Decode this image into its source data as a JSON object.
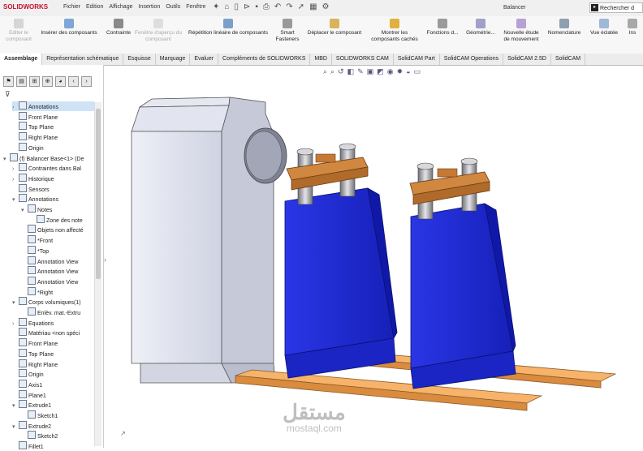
{
  "app": {
    "brand": "SOLIDWORKS",
    "document_title": "Balancer",
    "search_placeholder": "Rechercher d"
  },
  "menu": [
    "Fichier",
    "Edition",
    "Affichage",
    "Insertion",
    "Outils",
    "Fenêtre"
  ],
  "ribbon": {
    "commands": [
      {
        "label": "Editer le composant",
        "enabled": false
      },
      {
        "label": "Insérer des composants",
        "enabled": true
      },
      {
        "label": "Contrainte",
        "enabled": true
      },
      {
        "label": "Fenêtre d'aperçu du composant",
        "enabled": false
      },
      {
        "label": "Répétition linéaire de composants",
        "enabled": true
      },
      {
        "label": "Smart Fasteners",
        "enabled": true
      },
      {
        "label": "Déplacer le composant",
        "enabled": true
      },
      {
        "label": "Montrer les composants cachés",
        "enabled": true
      },
      {
        "label": "Fonctions d...",
        "enabled": true
      },
      {
        "label": "Géométrie...",
        "enabled": true
      },
      {
        "label": "Nouvelle étude de mouvement",
        "enabled": true
      },
      {
        "label": "Nomenclature",
        "enabled": true
      },
      {
        "label": "Vue éclatée",
        "enabled": true
      },
      {
        "label": "Ins",
        "enabled": true
      }
    ]
  },
  "command_tabs": [
    "Assemblage",
    "Représentation schématique",
    "Esquisse",
    "Marquage",
    "Evaluer",
    "Compléments de SOLIDWORKS",
    "MBD",
    "SOLIDWORKS CAM",
    "SolidCAM Part",
    "SolidCAM Operations",
    "SolidCAM 2.5D",
    "SolidCAM"
  ],
  "feature_tree": [
    {
      "label": "Annotations",
      "indent": 1,
      "exp": "›",
      "selected": true
    },
    {
      "label": "Front Plane",
      "indent": 1,
      "exp": ""
    },
    {
      "label": "Top Plane",
      "indent": 1,
      "exp": ""
    },
    {
      "label": "Right Plane",
      "indent": 1,
      "exp": ""
    },
    {
      "label": "Origin",
      "indent": 1,
      "exp": ""
    },
    {
      "label": "(f) Balancer Base<1> (De",
      "indent": 0,
      "exp": "▾"
    },
    {
      "label": "Contraintes dans Bal",
      "indent": 1,
      "exp": "›"
    },
    {
      "label": "Historique",
      "indent": 1,
      "exp": "›"
    },
    {
      "label": "Sensors",
      "indent": 1,
      "exp": ""
    },
    {
      "label": "Annotations",
      "indent": 1,
      "exp": "▾"
    },
    {
      "label": "Notes",
      "indent": 2,
      "exp": "▾"
    },
    {
      "label": "Zone des note",
      "indent": 3,
      "exp": ""
    },
    {
      "label": "Objets non affecté",
      "indent": 2,
      "exp": ""
    },
    {
      "label": "*Front",
      "indent": 2,
      "exp": ""
    },
    {
      "label": "*Top",
      "indent": 2,
      "exp": ""
    },
    {
      "label": "Annotation View",
      "indent": 2,
      "exp": ""
    },
    {
      "label": "Annotation View",
      "indent": 2,
      "exp": ""
    },
    {
      "label": "Annotation View",
      "indent": 2,
      "exp": ""
    },
    {
      "label": "*Right",
      "indent": 2,
      "exp": ""
    },
    {
      "label": "Corps volumiques(1)",
      "indent": 1,
      "exp": "▾"
    },
    {
      "label": "Enlèv. mat.-Extru",
      "indent": 2,
      "exp": ""
    },
    {
      "label": "Equations",
      "indent": 1,
      "exp": "›"
    },
    {
      "label": "Matériau <non spéci",
      "indent": 1,
      "exp": ""
    },
    {
      "label": "Front Plane",
      "indent": 1,
      "exp": ""
    },
    {
      "label": "Top Plane",
      "indent": 1,
      "exp": ""
    },
    {
      "label": "Right Plane",
      "indent": 1,
      "exp": ""
    },
    {
      "label": "Origin",
      "indent": 1,
      "exp": ""
    },
    {
      "label": "Axis1",
      "indent": 1,
      "exp": ""
    },
    {
      "label": "Plane1",
      "indent": 1,
      "exp": ""
    },
    {
      "label": "Extrude1",
      "indent": 1,
      "exp": "▾"
    },
    {
      "label": "Sketch1",
      "indent": 2,
      "exp": ""
    },
    {
      "label": "Extrude2",
      "indent": 1,
      "exp": "▾"
    },
    {
      "label": "Sketch2",
      "indent": 2,
      "exp": ""
    },
    {
      "label": "Fillet1",
      "indent": 1,
      "exp": ""
    }
  ],
  "watermark": {
    "arabic": "مستقل",
    "latin": "mostaql.com"
  },
  "colors": {
    "housing": "#d4d8e6",
    "blue_part": "#1c28d0",
    "orange_rail": "#f2a85c",
    "copper_clamp": "#c87a3c",
    "steel_post": "#a9aab0"
  }
}
